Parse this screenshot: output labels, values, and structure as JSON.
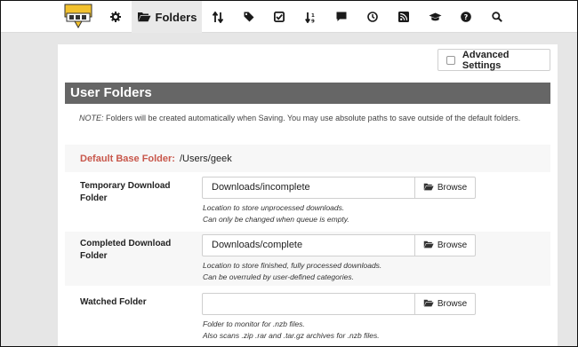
{
  "nav": {
    "items": [
      {
        "icon": "wrench-gear-icon"
      },
      {
        "icon": "folder-open-icon",
        "label": "Folders",
        "active": true
      },
      {
        "icon": "sort-arrows-icon"
      },
      {
        "icon": "tag-icon"
      },
      {
        "icon": "check-square-icon"
      },
      {
        "icon": "sort-numeric-icon"
      },
      {
        "icon": "comment-icon"
      },
      {
        "icon": "clock-icon"
      },
      {
        "icon": "rss-icon"
      },
      {
        "icon": "graduation-cap-icon"
      },
      {
        "icon": "question-circle-icon"
      },
      {
        "icon": "search-icon"
      }
    ]
  },
  "advanced_settings": {
    "label": "Advanced Settings",
    "checked": false
  },
  "section": {
    "title": "User Folders",
    "note_prefix": "NOTE:",
    "note_text": " Folders will be created automatically when Saving. You may use absolute paths to save outside of the default folders."
  },
  "base_folder": {
    "label": "Default Base Folder:",
    "value": "/Users/geek"
  },
  "fields": [
    {
      "label": "Temporary Download Folder",
      "value": "Downloads/incomplete",
      "browse": "Browse",
      "help": [
        "Location to store unprocessed downloads.",
        "Can only be changed when queue is empty."
      ]
    },
    {
      "label": "Completed Download Folder",
      "value": "Downloads/complete",
      "browse": "Browse",
      "help": [
        "Location to store finished, fully processed downloads.",
        "Can be overruled by user-defined categories."
      ]
    },
    {
      "label": "Watched Folder",
      "value": "",
      "browse": "Browse",
      "help": [
        "Folder to monitor for .nzb files.",
        "Also scans .zip .rar and .tar.gz archives for .nzb files."
      ]
    }
  ],
  "colors": {
    "accent_label": "#c8574b",
    "header_bg": "#666666"
  }
}
